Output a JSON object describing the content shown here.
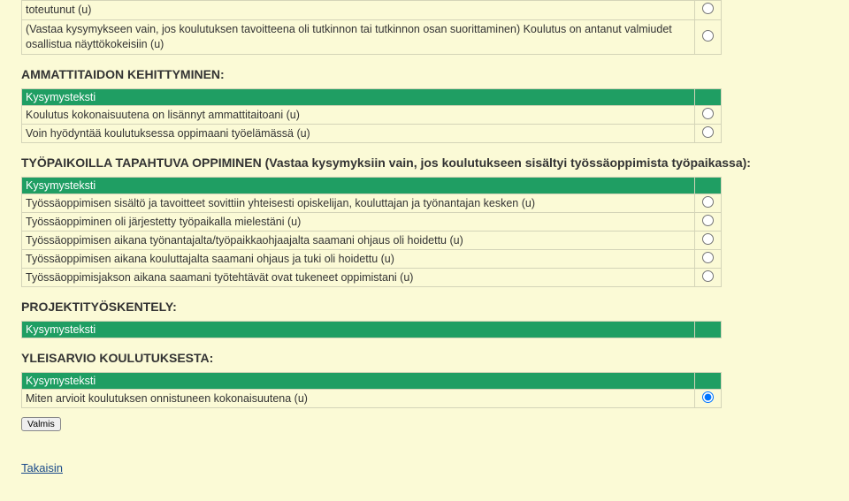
{
  "header_label": "Kysymysteksti",
  "pre_rows": [
    {
      "text": "toteutunut (u)",
      "radio": "○"
    },
    {
      "text": "(Vastaa kysymykseen vain, jos koulutuksen tavoitteena oli tutkinnon tai tutkinnon osan suorittaminen) Koulutus on antanut valmiudet osallistua näyttökokeisiin (u)",
      "radio": "○"
    }
  ],
  "sections": [
    {
      "title": "AMMATTITAIDON KEHITTYMINEN:",
      "rows": [
        {
          "text": "Koulutus kokonaisuutena on lisännyt ammattitaitoani (u)",
          "radio": "○"
        },
        {
          "text": "Voin hyödyntää koulutuksessa oppimaani työelämässä (u)",
          "radio": "○"
        }
      ]
    },
    {
      "title": "TYÖPAIKOILLA TAPAHTUVA OPPIMINEN (Vastaa kysymyksiin vain, jos koulutukseen sisältyi työssäoppimista työpaikassa):",
      "rows": [
        {
          "text": "Työssäoppimisen sisältö ja tavoitteet sovittiin yhteisesti opiskelijan, kouluttajan ja työnantajan kesken (u)",
          "radio": "○"
        },
        {
          "text": "Työssäoppiminen oli järjestetty työpaikalla mielestäni (u)",
          "radio": "○"
        },
        {
          "text": "Työssäoppimisen aikana työnantajalta/työpaikkaohjaajalta saamani ohjaus oli hoidettu (u)",
          "radio": "○"
        },
        {
          "text": "Työssäoppimisen aikana kouluttajalta saamani ohjaus ja tuki oli hoidettu (u)",
          "radio": "○"
        },
        {
          "text": "Työssäoppimisjakson aikana saamani työtehtävät ovat tukeneet oppimistani (u)",
          "radio": "○"
        }
      ]
    },
    {
      "title": "PROJEKTITYÖSKENTELY:",
      "rows": []
    },
    {
      "title": "YLEISARVIO KOULUTUKSESTA:",
      "rows": [
        {
          "text": "Miten arvioit koulutuksen onnistuneen kokonaisuutena (u)",
          "radio": "●"
        }
      ]
    }
  ],
  "button_label": "Valmis",
  "back_label": "Takaisin"
}
